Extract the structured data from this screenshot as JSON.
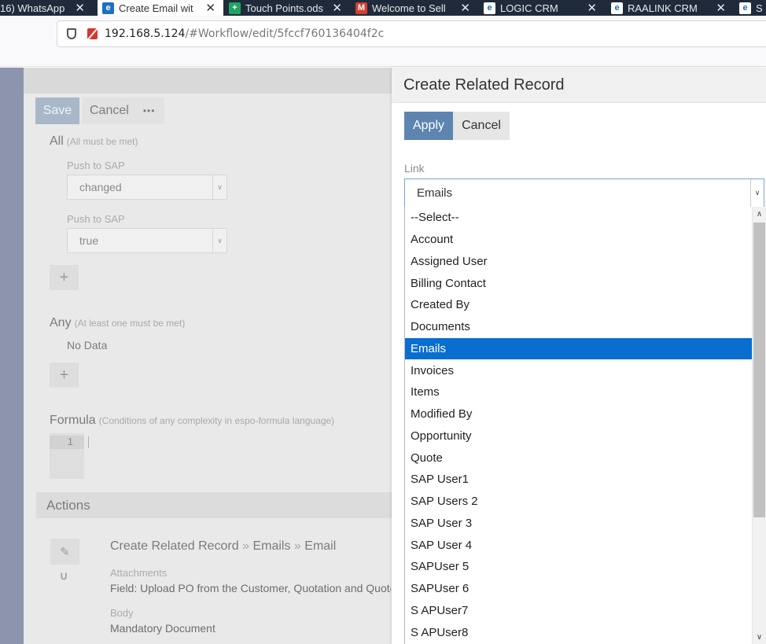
{
  "browser": {
    "tabs": [
      {
        "label": "16) WhatsApp",
        "icon": "",
        "active": false
      },
      {
        "label": "Create Email wit",
        "icon": "espo-icon",
        "active": true
      },
      {
        "label": "Touch Points.ods",
        "icon": "sheet-icon",
        "active": false
      },
      {
        "label": "Welcome to Sell",
        "icon": "gmail-icon",
        "active": false
      },
      {
        "label": "LOGIC CRM",
        "icon": "espo-icon",
        "active": false
      },
      {
        "label": "RAALINK CRM",
        "icon": "espo-icon",
        "active": false
      },
      {
        "label": "S",
        "icon": "espo-icon",
        "active": false
      }
    ],
    "tab_close_glyph": "✕",
    "url_host": "192.168.5.124",
    "url_path": "/#Workflow/edit/5fccf760136404f2c"
  },
  "workflow": {
    "save_label": "Save",
    "cancel_label": "Cancel",
    "more_label": "•••",
    "all_heading": "All",
    "all_hint": "(All must be met)",
    "conditions": [
      {
        "label": "Push to SAP",
        "value": "changed"
      },
      {
        "label": "Push to SAP",
        "value": "true"
      }
    ],
    "add_label": "+",
    "any_heading": "Any",
    "any_hint": "(At least one must be met)",
    "any_empty": "No Data",
    "formula_heading": "Formula",
    "formula_hint": "(Conditions of any complexity in espo-formula language)",
    "formula_line_no": "1",
    "actions_heading": "Actions",
    "action": {
      "title_parts": [
        "Create Related Record",
        "Emails",
        "Email"
      ],
      "title_sep": "»",
      "attachments_label": "Attachments",
      "attachments_value": "Field: Upload PO from the Customer, Quotation and Quote",
      "body_label": "Body",
      "body_value": "Mandatory Document"
    }
  },
  "modal": {
    "title": "Create Related Record",
    "apply_label": "Apply",
    "cancel_label": "Cancel",
    "link_label": "Link",
    "link_value": "Emails",
    "options": [
      "--Select--",
      "Account",
      "Assigned User",
      "Billing Contact",
      "Created By",
      "Documents",
      "Emails",
      "Invoices",
      "Items",
      "Modified By",
      "Opportunity",
      "Quote",
      "SAP User1",
      "SAP Users 2",
      "SAP User 3",
      "SAP User 4",
      "SAPUser 5",
      "SAPUser 6",
      "S APUser7",
      "S APUser8"
    ],
    "selected_option": "Emails"
  },
  "colors": {
    "primary": "#5d85b0",
    "selected_option_bg": "#0a6ed0",
    "insecure_icon": "#d8352c"
  }
}
